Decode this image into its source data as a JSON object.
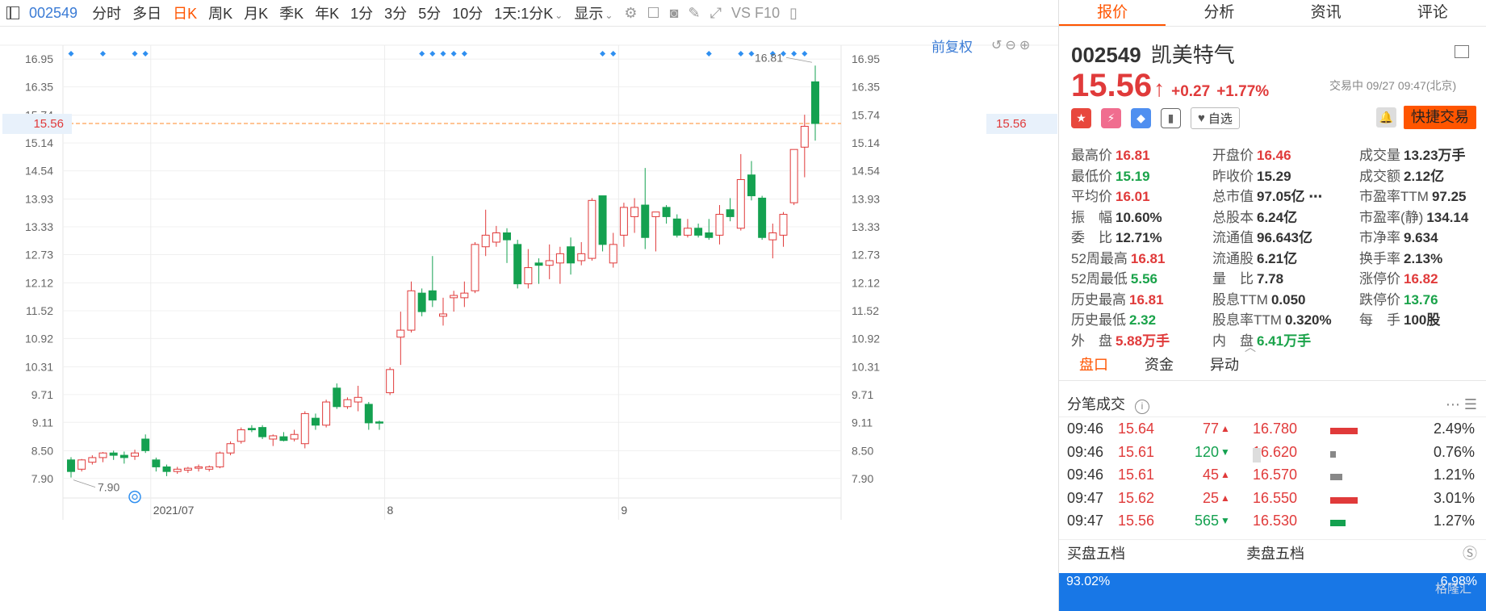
{
  "toolbar": {
    "code": "002549",
    "periods": [
      "分时",
      "多日",
      "日K",
      "周K",
      "月K",
      "季K",
      "年K",
      "1分",
      "3分",
      "5分",
      "10分",
      "1天:1分K"
    ],
    "active_period": "日K",
    "display_label": "显示",
    "extra_label": "VS F10"
  },
  "chart": {
    "adjust_label": "前复权",
    "current_price_label": "15.56",
    "current_price": 15.56,
    "y_ticks": [
      "16.95",
      "16.35",
      "15.74",
      "15.14",
      "14.54",
      "13.93",
      "13.33",
      "12.73",
      "12.12",
      "11.52",
      "10.92",
      "10.31",
      "9.71",
      "9.11",
      "8.50",
      "7.90"
    ],
    "y_tick_values": [
      16.95,
      16.35,
      15.74,
      15.14,
      14.54,
      13.93,
      13.33,
      12.73,
      12.12,
      11.52,
      10.92,
      10.31,
      9.71,
      9.11,
      8.5,
      7.9
    ],
    "x_labels": [
      {
        "label": "2021/07",
        "index": 8
      },
      {
        "label": "8",
        "index": 30
      },
      {
        "label": "9",
        "index": 52
      }
    ],
    "max_label": "16.81",
    "min_label": "7.90",
    "colors": {
      "up": "#e03a3a",
      "down": "#14a150",
      "dash": "#ff8a2a",
      "marker": "#2f8ff0"
    }
  },
  "chart_data": {
    "type": "candlestick",
    "y_range": [
      7.6,
      17.25
    ],
    "candles": [
      [
        8.3,
        8.05,
        8.36,
        7.92
      ],
      [
        8.1,
        8.3,
        8.32,
        8.05
      ],
      [
        8.25,
        8.35,
        8.4,
        8.2
      ],
      [
        8.35,
        8.45,
        8.47,
        8.25
      ],
      [
        8.45,
        8.4,
        8.5,
        8.3
      ],
      [
        8.4,
        8.35,
        8.48,
        8.22
      ],
      [
        8.38,
        8.45,
        8.52,
        8.3
      ],
      [
        8.75,
        8.5,
        8.85,
        8.45
      ],
      [
        8.3,
        8.15,
        8.35,
        8.05
      ],
      [
        8.15,
        8.05,
        8.2,
        7.95
      ],
      [
        8.05,
        8.1,
        8.15,
        8.0
      ],
      [
        8.08,
        8.12,
        8.15,
        8.02
      ],
      [
        8.12,
        8.15,
        8.2,
        8.05
      ],
      [
        8.1,
        8.15,
        8.18,
        8.05
      ],
      [
        8.15,
        8.45,
        8.48,
        8.12
      ],
      [
        8.45,
        8.65,
        8.7,
        8.4
      ],
      [
        8.7,
        8.95,
        9.0,
        8.65
      ],
      [
        8.98,
        8.95,
        9.05,
        8.9
      ],
      [
        9.0,
        8.8,
        9.05,
        8.75
      ],
      [
        8.75,
        8.82,
        8.85,
        8.6
      ],
      [
        8.8,
        8.72,
        8.9,
        8.7
      ],
      [
        8.75,
        8.85,
        8.95,
        8.7
      ],
      [
        8.65,
        9.3,
        9.35,
        8.55
      ],
      [
        9.2,
        9.05,
        9.3,
        8.95
      ],
      [
        9.05,
        9.55,
        9.6,
        9.0
      ],
      [
        9.85,
        9.45,
        9.95,
        9.4
      ],
      [
        9.45,
        9.6,
        9.65,
        9.4
      ],
      [
        9.55,
        9.65,
        9.9,
        9.35
      ],
      [
        9.5,
        9.1,
        9.55,
        8.95
      ],
      [
        9.12,
        9.1,
        9.15,
        8.95
      ],
      [
        9.75,
        10.25,
        10.3,
        9.7
      ],
      [
        10.95,
        11.1,
        11.5,
        10.35
      ],
      [
        11.1,
        11.95,
        12.15,
        11.05
      ],
      [
        11.9,
        11.5,
        12.0,
        11.4
      ],
      [
        11.95,
        11.75,
        12.7,
        11.6
      ],
      [
        11.4,
        11.45,
        11.8,
        11.2
      ],
      [
        11.8,
        11.85,
        11.95,
        11.5
      ],
      [
        11.8,
        11.9,
        12.15,
        11.6
      ],
      [
        11.95,
        12.95,
        13.0,
        11.9
      ],
      [
        12.9,
        13.15,
        13.7,
        12.7
      ],
      [
        13.0,
        13.2,
        13.35,
        12.9
      ],
      [
        13.2,
        13.05,
        13.3,
        12.55
      ],
      [
        12.95,
        12.1,
        13.05,
        12.0
      ],
      [
        12.1,
        12.45,
        12.85,
        12.0
      ],
      [
        12.55,
        12.5,
        12.65,
        12.1
      ],
      [
        12.5,
        12.6,
        12.95,
        12.2
      ],
      [
        12.55,
        12.75,
        12.9,
        12.1
      ],
      [
        12.9,
        12.55,
        13.1,
        12.3
      ],
      [
        12.6,
        12.75,
        13.0,
        12.5
      ],
      [
        12.65,
        13.9,
        13.95,
        12.6
      ],
      [
        14.0,
        12.95,
        14.0,
        12.8
      ],
      [
        12.55,
        12.95,
        13.2,
        12.45
      ],
      [
        13.15,
        13.75,
        13.85,
        12.9
      ],
      [
        13.55,
        13.75,
        13.95,
        13.2
      ],
      [
        13.8,
        13.1,
        14.6,
        12.85
      ],
      [
        13.55,
        13.65,
        13.65,
        12.8
      ],
      [
        13.75,
        13.55,
        13.8,
        13.4
      ],
      [
        13.5,
        13.15,
        13.6,
        13.1
      ],
      [
        13.15,
        13.3,
        13.5,
        13.1
      ],
      [
        13.3,
        13.15,
        13.4,
        13.1
      ],
      [
        13.2,
        13.1,
        13.5,
        13.05
      ],
      [
        13.15,
        13.6,
        13.8,
        12.95
      ],
      [
        13.7,
        13.55,
        13.95,
        13.45
      ],
      [
        13.3,
        14.35,
        14.9,
        13.25
      ],
      [
        14.45,
        14.0,
        14.75,
        13.9
      ],
      [
        13.95,
        13.1,
        14.0,
        13.05
      ],
      [
        13.05,
        13.2,
        13.4,
        12.65
      ],
      [
        13.15,
        13.6,
        13.65,
        12.9
      ],
      [
        13.85,
        15.0,
        15.0,
        13.8
      ],
      [
        15.05,
        15.5,
        15.75,
        14.4
      ],
      [
        16.46,
        15.56,
        16.81,
        15.19
      ]
    ],
    "marker_indices": [
      0,
      3,
      6,
      7,
      33,
      34,
      35,
      36,
      37,
      50,
      51,
      60,
      63,
      64,
      66,
      67,
      68,
      69
    ]
  },
  "panel": {
    "tabs": [
      "报价",
      "分析",
      "资讯",
      "评论"
    ],
    "active_tab": "报价",
    "code": "002549",
    "name": "凯美特气",
    "price": "15.56",
    "arrow": "↑",
    "change": "+0.27",
    "change_pct": "+1.77%",
    "status": "交易中 09/27 09:47(北京)",
    "watch_label": "自选",
    "trade_label": "快捷交易",
    "quote": [
      {
        "label": "最高价",
        "value": "16.81",
        "color": "red"
      },
      {
        "label": "开盘价",
        "value": "16.46",
        "color": "red"
      },
      {
        "label": "成交量",
        "value": "13.23万手",
        "color": "dark"
      },
      {
        "label": "最低价",
        "value": "15.19",
        "color": "green"
      },
      {
        "label": "昨收价",
        "value": "15.29",
        "color": "dark"
      },
      {
        "label": "成交额",
        "value": "2.12亿",
        "color": "dark"
      },
      {
        "label": "平均价",
        "value": "16.01",
        "color": "red"
      },
      {
        "label": "总市值",
        "value": "97.05亿 ⋯",
        "color": "dark"
      },
      {
        "label": "市盈率TTM",
        "value": "97.25",
        "color": "dark"
      },
      {
        "label": "振　幅",
        "value": "10.60%",
        "color": "dark"
      },
      {
        "label": "总股本",
        "value": "6.24亿",
        "color": "dark"
      },
      {
        "label": "市盈率(静)",
        "value": "134.14",
        "color": "dark"
      },
      {
        "label": "委　比",
        "value": "12.71%",
        "color": "dark"
      },
      {
        "label": "流通值",
        "value": "96.643亿",
        "color": "dark"
      },
      {
        "label": "市净率",
        "value": "9.634",
        "color": "dark"
      },
      {
        "label": "52周最高",
        "value": "16.81",
        "color": "red"
      },
      {
        "label": "流通股",
        "value": "6.21亿",
        "color": "dark"
      },
      {
        "label": "换手率",
        "value": "2.13%",
        "color": "dark"
      },
      {
        "label": "52周最低",
        "value": "5.56",
        "color": "green"
      },
      {
        "label": "量　比",
        "value": "7.78",
        "color": "dark"
      },
      {
        "label": "涨停价",
        "value": "16.82",
        "color": "red"
      },
      {
        "label": "历史最高",
        "value": "16.81",
        "color": "red"
      },
      {
        "label": "股息TTM",
        "value": "0.050",
        "color": "dark"
      },
      {
        "label": "跌停价",
        "value": "13.76",
        "color": "green"
      },
      {
        "label": "历史最低",
        "value": "2.32",
        "color": "green"
      },
      {
        "label": "股息率TTM",
        "value": "0.320%",
        "color": "dark"
      },
      {
        "label": "每　手",
        "value": "100股",
        "color": "dark"
      },
      {
        "label": "外　盘",
        "value": "5.88万手",
        "color": "red"
      },
      {
        "label": "内　盘",
        "value": "6.41万手",
        "color": "green"
      },
      {
        "label": "",
        "value": "",
        "color": "dark"
      }
    ],
    "subtabs": [
      "盘口",
      "资金",
      "异动"
    ],
    "active_subtab": "盘口",
    "ticks_title": "分笔成交",
    "ticks": [
      {
        "time": "09:46",
        "price": "15.64",
        "vol": "77",
        "dir": "up",
        "level": "16.780",
        "bar_color": "#e03a3a",
        "bar_frac": 1.0,
        "pct": "2.49%"
      },
      {
        "time": "09:46",
        "price": "15.61",
        "vol": "120",
        "dir": "down",
        "level": "16.620",
        "bar_color": "#888888",
        "bar_frac": 0.22,
        "pct": "0.76%"
      },
      {
        "time": "09:46",
        "price": "15.61",
        "vol": "45",
        "dir": "up",
        "level": "16.570",
        "bar_color": "#888888",
        "bar_frac": 0.45,
        "pct": "1.21%"
      },
      {
        "time": "09:47",
        "price": "15.62",
        "vol": "25",
        "dir": "up",
        "level": "16.550",
        "bar_color": "#e03a3a",
        "bar_frac": 1.0,
        "pct": "3.01%"
      },
      {
        "time": "09:47",
        "price": "15.56",
        "vol": "565",
        "dir": "down",
        "level": "16.530",
        "bar_color": "#14a150",
        "bar_frac": 0.55,
        "pct": "1.27%"
      }
    ],
    "buy5_label": "买盘五档",
    "sell5_label": "卖盘五档",
    "bottom_left": "93.02%",
    "bottom_right": "6.98%",
    "watermark": "格隆汇"
  }
}
